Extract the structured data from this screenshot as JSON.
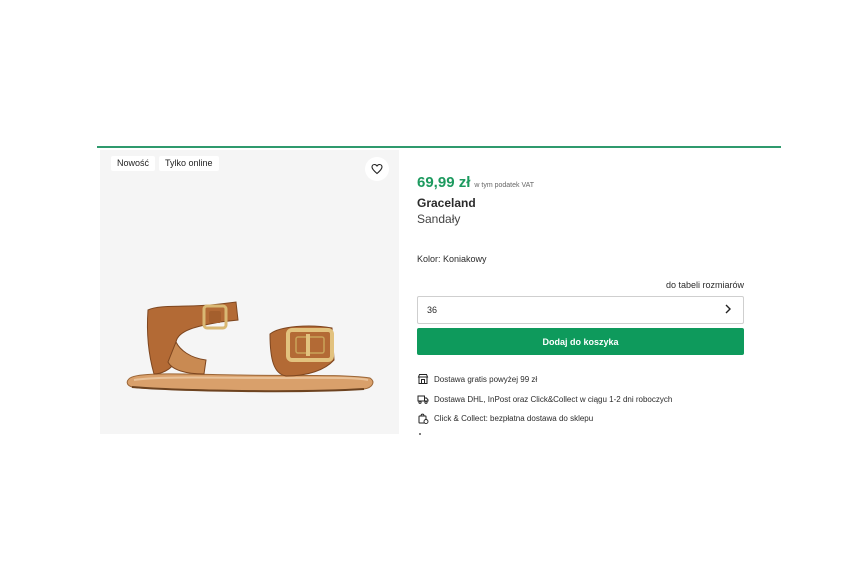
{
  "badges": [
    "Nowość",
    "Tylko online"
  ],
  "product": {
    "price": "69,99 zł",
    "vat_note": "w tym podatek VAT",
    "brand": "Graceland",
    "category": "Sandały",
    "color_label": "Kolor:",
    "color_value": "Koniakowy"
  },
  "size": {
    "table_link": "do tabeli rozmiarów",
    "selected": "36"
  },
  "add_to_cart_label": "Dodaj do koszyka",
  "delivery": [
    {
      "icon": "store-icon",
      "text": "Dostawa gratis powyżej 99 zł"
    },
    {
      "icon": "truck-icon",
      "text": "Dostawa DHL, InPost oraz Click&Collect w ciągu 1-2 dni roboczych"
    },
    {
      "icon": "bag-icon",
      "text": "Click & Collect: bezpłatna dostawa do sklepu"
    }
  ],
  "colors": {
    "accent": "#0e9a5c",
    "price": "#1d9a5f",
    "divider": "#2f9a6d"
  }
}
